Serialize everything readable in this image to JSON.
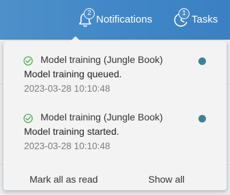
{
  "header": {
    "notifications": {
      "label": "Notifications",
      "badge": "2",
      "icon": "bell-icon"
    },
    "tasks": {
      "label": "Tasks",
      "badge": "1",
      "icon": "tasks-clock-icon"
    }
  },
  "notifications": [
    {
      "title": "Model training (Jungle Book)",
      "message": "Model training queued.",
      "timestamp": "2023-03-28 10:10:48",
      "status_icon": "check-circle-icon",
      "unread": true
    },
    {
      "title": "Model training (Jungle Book)",
      "message": "Model training started.",
      "timestamp": "2023-03-28 10:10:48",
      "status_icon": "check-circle-icon",
      "unread": true
    }
  ],
  "footer": {
    "mark_all_label": "Mark all as read",
    "show_all_label": "Show all"
  },
  "colors": {
    "header_blue": "#3f86c7",
    "success_green": "#4caf50",
    "unread_dot": "#3d8197"
  }
}
